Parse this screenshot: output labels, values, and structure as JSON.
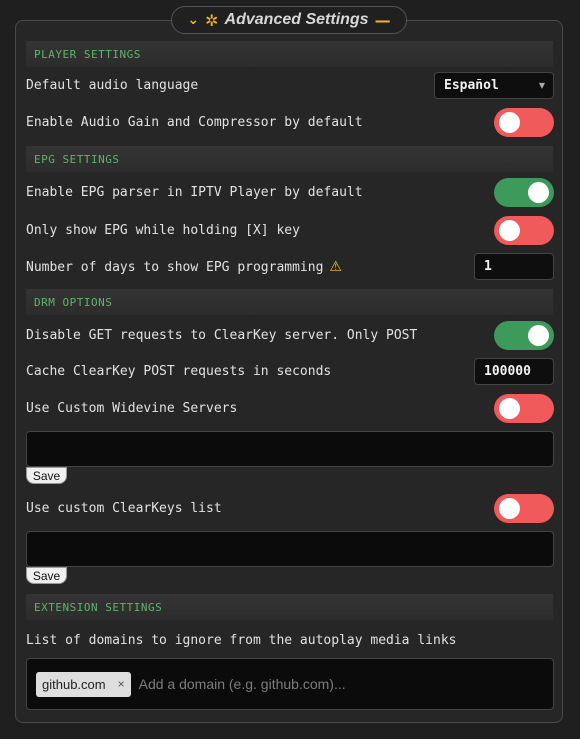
{
  "panel": {
    "title": "Advanced Settings"
  },
  "sections": {
    "player": "PLAYER SETTINGS",
    "epg": "EPG SETTINGS",
    "drm": "DRM OPTIONS",
    "extension": "EXTENSION SETTINGS"
  },
  "settings": {
    "audio_language": {
      "label": "Default audio language",
      "value": "Español"
    },
    "audio_gain": {
      "label": "Enable Audio Gain and Compressor by default",
      "enabled": false
    },
    "epg_parser": {
      "label": "Enable EPG parser in IPTV Player by default",
      "enabled": true
    },
    "epg_hold_x": {
      "label": "Only show EPG while holding [X] key",
      "enabled": false
    },
    "epg_days": {
      "label": "Number of days to show EPG programming",
      "value": "1"
    },
    "disable_get": {
      "label": "Disable GET requests to ClearKey server. Only POST",
      "enabled": true
    },
    "cache_clearkey": {
      "label": "Cache ClearKey POST requests in seconds",
      "value": "100000"
    },
    "custom_widevine": {
      "label": "Use Custom Widevine Servers",
      "enabled": false,
      "textarea_value": "",
      "save_label": "Save"
    },
    "custom_clearkeys": {
      "label": "Use custom ClearKeys list",
      "enabled": false,
      "textarea_value": "",
      "save_label": "Save"
    },
    "ignore_domains": {
      "label": "List of domains to ignore from the autoplay media links",
      "tags": [
        "github.com"
      ],
      "remove_glyph": "×",
      "placeholder": "Add a domain (e.g. github.com)..."
    }
  },
  "colors": {
    "accent": "#f0b429",
    "section_text": "#5fb36d",
    "toggle_on": "#3e9a5a",
    "toggle_off": "#f05a5a"
  }
}
